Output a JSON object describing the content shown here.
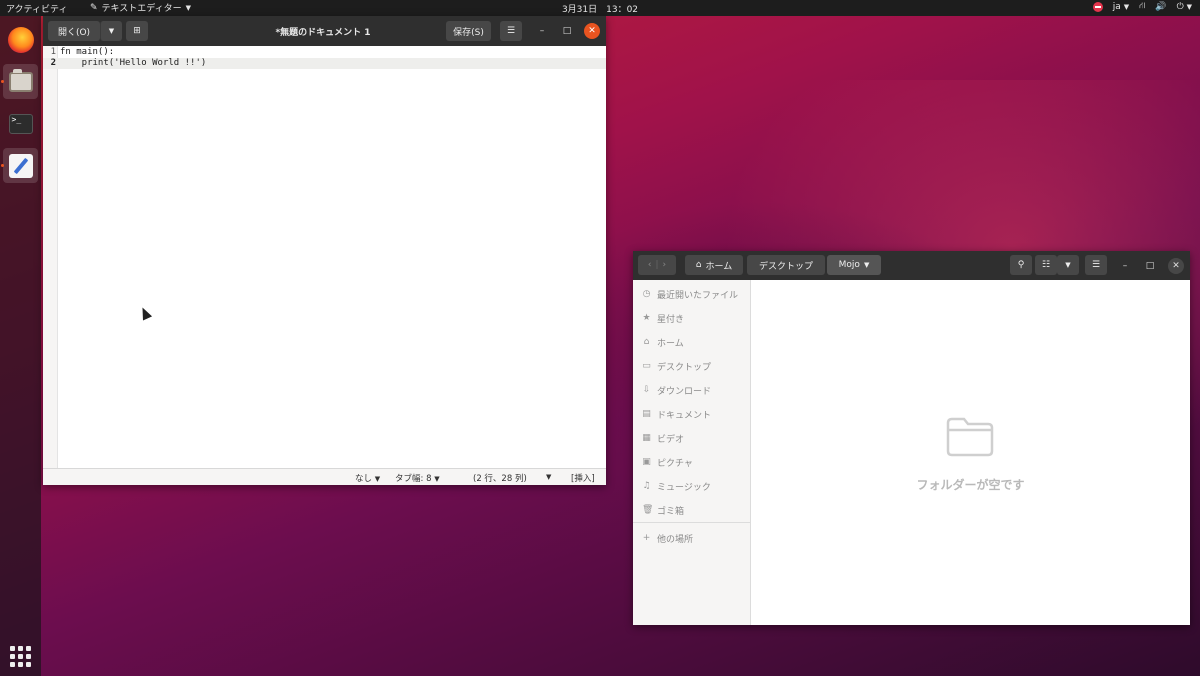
{
  "topbar": {
    "activities": "アクティビティ",
    "app_menu": "テキストエディター",
    "clock": "3月31日　13：02",
    "input_method": "ja"
  },
  "dock": {
    "items": [
      "firefox",
      "files",
      "terminal",
      "text-editor"
    ],
    "terminal_glyph": ">_"
  },
  "gedit": {
    "open_label": "開く(O)",
    "title": "*無題のドキュメント 1",
    "save_label": "保存(S)",
    "lines": [
      {
        "num": "1",
        "code": "fn main():"
      },
      {
        "num": "2",
        "code": "    print('Hello World !!')"
      }
    ],
    "status": {
      "syntax": "なし",
      "tab_width": "タブ幅: 8",
      "position": "(2 行、28 列)",
      "mode": "[挿入]"
    }
  },
  "nautilus": {
    "path": [
      "ホーム",
      "デスクトップ",
      "Mojo"
    ],
    "sidebar": [
      {
        "icon": "recent-icon",
        "label": "最近開いたファイル"
      },
      {
        "icon": "star-icon",
        "label": "星付き"
      },
      {
        "icon": "home-icon",
        "label": "ホーム"
      },
      {
        "icon": "desktop-icon",
        "label": "デスクトップ"
      },
      {
        "icon": "download-icon",
        "label": "ダウンロード"
      },
      {
        "icon": "document-icon",
        "label": "ドキュメント"
      },
      {
        "icon": "video-icon",
        "label": "ビデオ"
      },
      {
        "icon": "picture-icon",
        "label": "ピクチャ"
      },
      {
        "icon": "music-icon",
        "label": "ミュージック"
      },
      {
        "icon": "trash-icon",
        "label": "ゴミ箱"
      }
    ],
    "other_locations": "他の場所",
    "empty_message": "フォルダーが空です"
  },
  "colors": {
    "accent": "#e95420",
    "headerbar": "#2f2f2f"
  }
}
